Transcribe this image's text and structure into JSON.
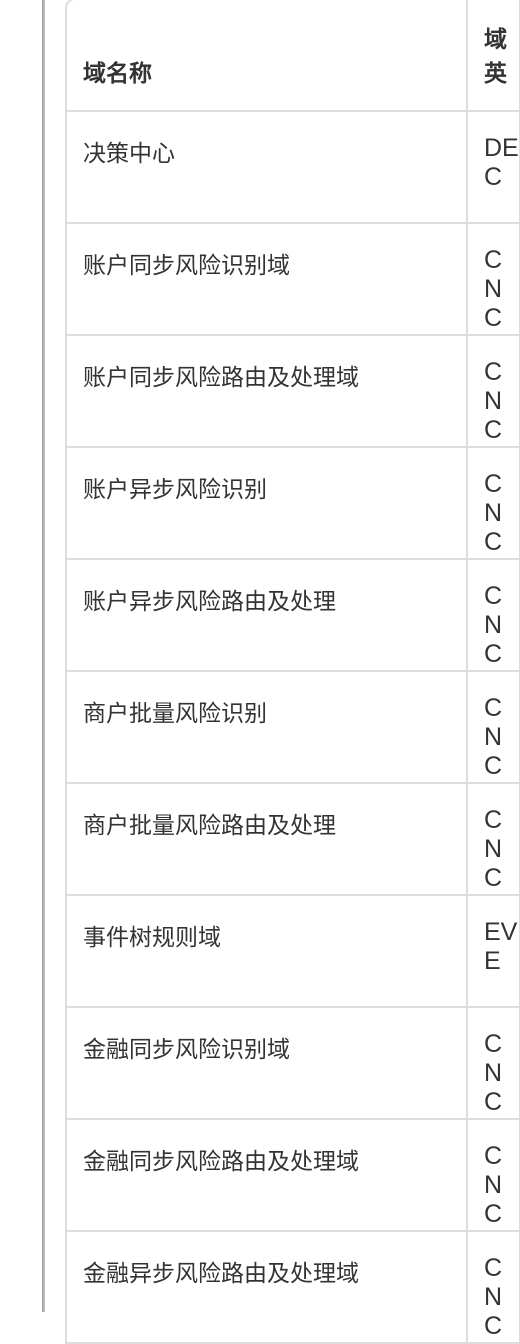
{
  "table": {
    "headers": [
      "域名称",
      "域英"
    ],
    "rows": [
      {
        "name": "决策中心",
        "code": "DEC"
      },
      {
        "name": "账户同步风险识别域",
        "code": "CNC"
      },
      {
        "name": "账户同步风险路由及处理域",
        "code": "CNC"
      },
      {
        "name": "账户异步风险识别",
        "code": "CNC"
      },
      {
        "name": "账户异步风险路由及处理",
        "code": "CNC"
      },
      {
        "name": "商户批量风险识别",
        "code": "CNC"
      },
      {
        "name": "商户批量风险路由及处理",
        "code": "CNC"
      },
      {
        "name": "事件树规则域",
        "code": "EVE"
      },
      {
        "name": "金融同步风险识别域",
        "code": "CNC"
      },
      {
        "name": "金融同步风险路由及处理域",
        "code": "CNC"
      },
      {
        "name": "金融异步风险路由及处理域",
        "code": "CNC"
      }
    ]
  }
}
